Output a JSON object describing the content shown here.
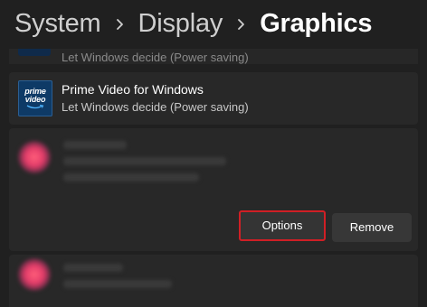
{
  "breadcrumb": {
    "items": [
      "System",
      "Display"
    ],
    "current": "Graphics"
  },
  "partial_row": {
    "subtitle": "Let Windows decide (Power saving)"
  },
  "app_row": {
    "icon_text_line1": "prime",
    "icon_text_line2": "video",
    "name": "Prime Video for Windows",
    "subtitle": "Let Windows decide (Power saving)"
  },
  "expanded_row": {
    "options_label": "Options",
    "remove_label": "Remove"
  },
  "colors": {
    "background": "#202020",
    "card": "#282828",
    "highlight": "#d01f25",
    "prime_blue": "#0e3a66"
  },
  "icons": {
    "chevron": "chevron-right-icon",
    "app": "prime-video-icon",
    "blurred": "blurred-app-icon"
  }
}
